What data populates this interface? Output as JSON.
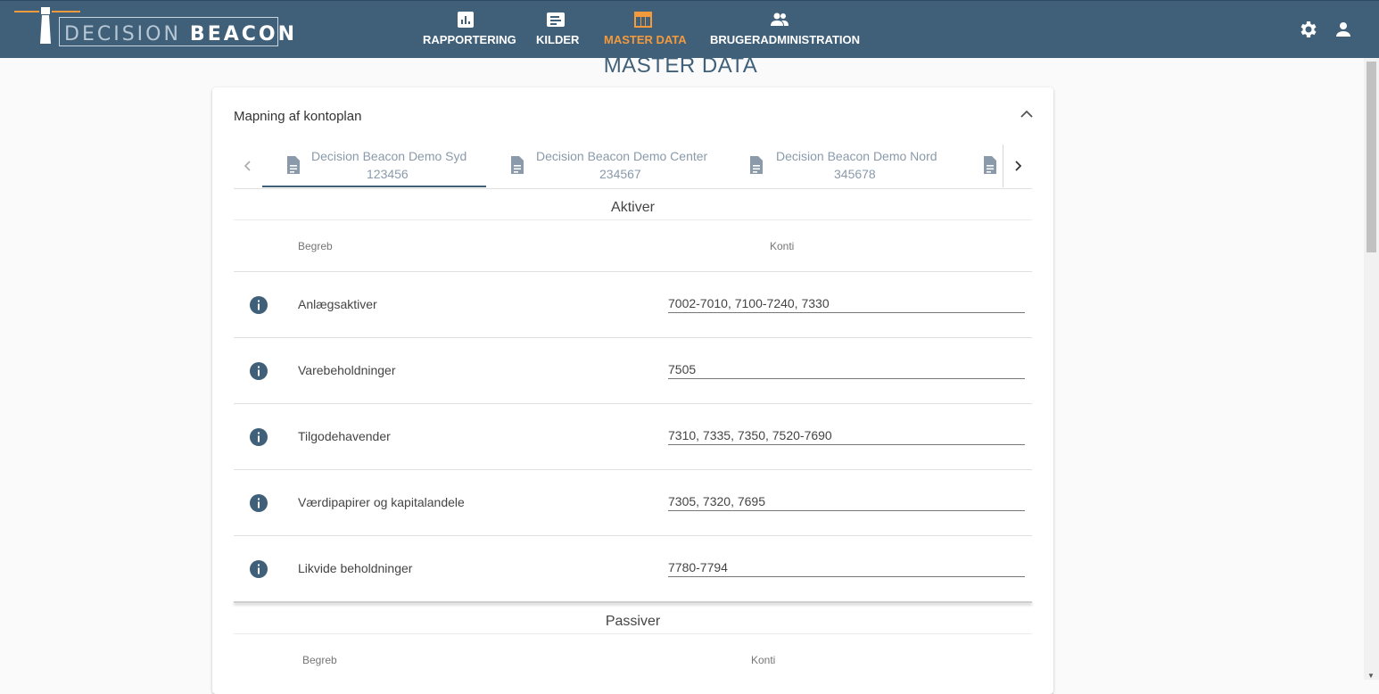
{
  "app": {
    "logo_light": "DECISION",
    "logo_bold": "BEACON"
  },
  "nav": [
    {
      "label": "RAPPORTERING",
      "icon": "bar-chart-icon",
      "active": false
    },
    {
      "label": "KILDER",
      "icon": "document-list-icon",
      "active": false
    },
    {
      "label": "MASTER DATA",
      "icon": "table-icon",
      "active": true
    },
    {
      "label": "BRUGERADMINISTRATION",
      "icon": "users-icon",
      "active": false
    }
  ],
  "header_right": {
    "settings_icon": "gear-icon",
    "profile_icon": "person-icon"
  },
  "colors": {
    "topbar": "#40607a",
    "accent": "#f39a3d",
    "icon_dark": "#40607a"
  },
  "page": {
    "title": "MASTER DATA"
  },
  "card": {
    "title": "Mapning af kontoplan",
    "tabs": [
      {
        "name": "Decision Beacon Demo Syd",
        "number": "123456",
        "active": true
      },
      {
        "name": "Decision Beacon Demo Center",
        "number": "234567",
        "active": false
      },
      {
        "name": "Decision Beacon Demo Nord",
        "number": "345678",
        "active": false
      }
    ],
    "sections": {
      "aktiver": {
        "title": "Aktiver",
        "col_term": "Begreb",
        "col_accounts": "Konti",
        "rows": [
          {
            "label": "Anlægsaktiver",
            "value": "7002-7010, 7100-7240, 7330"
          },
          {
            "label": "Varebeholdninger",
            "value": "7505"
          },
          {
            "label": "Tilgodehavender",
            "value": "7310, 7335, 7350, 7520-7690"
          },
          {
            "label": "Værdipapirer og kapitalandele",
            "value": "7305, 7320, 7695"
          },
          {
            "label": "Likvide beholdninger",
            "value": "7780-7794"
          }
        ]
      },
      "passiver": {
        "title": "Passiver",
        "col_term": "Begreb",
        "col_accounts": "Konti"
      }
    }
  }
}
